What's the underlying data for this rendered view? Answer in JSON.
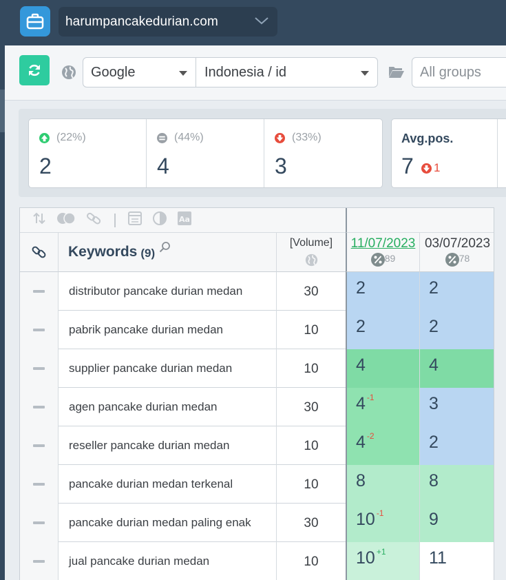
{
  "header": {
    "site": "harumpancakedurian.com"
  },
  "filters": {
    "search_engine": "Google",
    "location": "Indonesia / id",
    "groups_placeholder": "All groups"
  },
  "summary": {
    "up": {
      "percent": "(22%)",
      "count": "2"
    },
    "same": {
      "percent": "(44%)",
      "count": "4"
    },
    "down": {
      "percent": "(33%)",
      "count": "3"
    },
    "avg": {
      "label": "Avg.pos.",
      "value": "7",
      "change": "1"
    }
  },
  "table": {
    "keywords_title": "Keywords",
    "keywords_count": "(9)",
    "volume_label": "[Volume]",
    "dates": [
      {
        "date": "11/07/2023",
        "pct": "89"
      },
      {
        "date": "03/07/2023",
        "pct": "78"
      }
    ],
    "rows": [
      {
        "keyword": "distributor pancake durian medan",
        "volume": "30",
        "rank1": "2",
        "change1": "",
        "rank2": "2"
      },
      {
        "keyword": "pabrik pancake durian medan",
        "volume": "10",
        "rank1": "2",
        "change1": "",
        "rank2": "2"
      },
      {
        "keyword": "supplier pancake durian medan",
        "volume": "10",
        "rank1": "4",
        "change1": "",
        "rank2": "4"
      },
      {
        "keyword": "agen pancake durian medan",
        "volume": "30",
        "rank1": "4",
        "change1": "-1",
        "rank2": "3"
      },
      {
        "keyword": "reseller pancake durian medan",
        "volume": "10",
        "rank1": "4",
        "change1": "-2",
        "rank2": "2"
      },
      {
        "keyword": "pancake durian medan terkenal",
        "volume": "10",
        "rank1": "8",
        "change1": "",
        "rank2": "8"
      },
      {
        "keyword": "pancake durian medan paling enak",
        "volume": "30",
        "rank1": "10",
        "change1": "-1",
        "rank2": "9"
      },
      {
        "keyword": "jual pancake durian medan",
        "volume": "10",
        "rank1": "10",
        "change1": "+1",
        "rank2": "11"
      }
    ]
  },
  "colors": {
    "rank_top3": "#b9d6f2",
    "rank_top5": "#7fdba5",
    "rank_top5_changed": "#8fe2b0",
    "rank_top10": "#b2ebcb",
    "rank_top10_light": "#c9f1da",
    "rank_out": "#ffffff"
  }
}
